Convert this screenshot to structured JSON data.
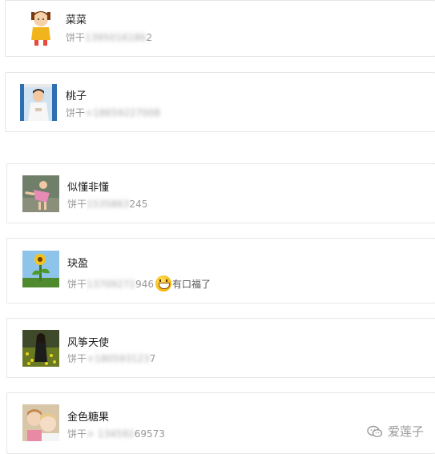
{
  "contacts": [
    {
      "name": "菜菜",
      "phone_prefix": "饼干",
      "phone_blur": "1395016186",
      "phone_clear": "2",
      "note": ""
    },
    {
      "name": "桃子",
      "phone_prefix": "饼干",
      "phone_blur": "+18659227008",
      "phone_clear": "",
      "note": ""
    },
    {
      "name": "似懂非懂",
      "phone_prefix": "饼干",
      "phone_blur": "1535863",
      "phone_clear": "245",
      "note": ""
    },
    {
      "name": "玦盈",
      "phone_prefix": "饼干",
      "phone_blur": "13709272",
      "phone_clear": "946",
      "note": "有口福了"
    },
    {
      "name": "风筝天使",
      "phone_prefix": "饼干",
      "phone_blur": "+180593123",
      "phone_clear": "7",
      "note": ""
    },
    {
      "name": "金色糖果",
      "phone_prefix": "饼干",
      "phone_blur": "+ 134592",
      "phone_clear": "69573",
      "note": ""
    }
  ],
  "watermark": {
    "text": "爱莲子"
  },
  "icons": {
    "emoji": "grin-emoji-icon",
    "wechat": "wechat-logo-icon"
  }
}
